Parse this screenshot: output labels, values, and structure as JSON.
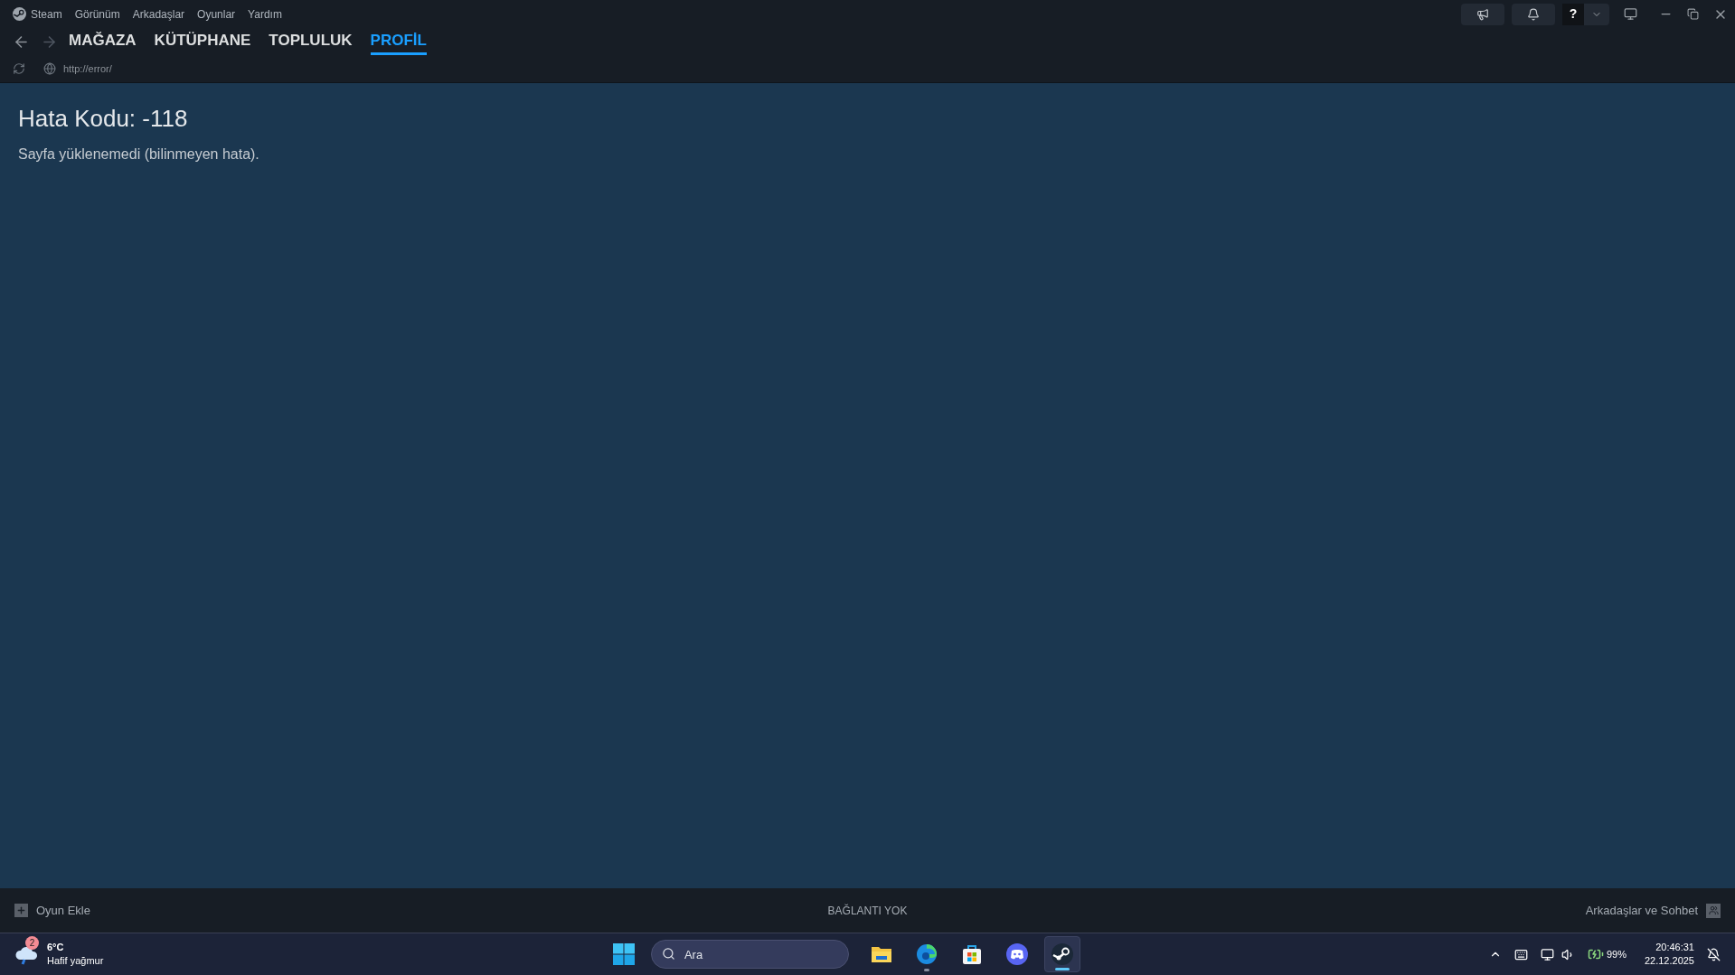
{
  "menu": [
    "Steam",
    "Görünüm",
    "Arkadaşlar",
    "Oyunlar",
    "Yardım"
  ],
  "tabs": [
    {
      "label": "MAĞAZA",
      "selected": false
    },
    {
      "label": "KÜTÜPHANE",
      "selected": false
    },
    {
      "label": "TOPLULUK",
      "selected": false
    },
    {
      "label": "PROFİL",
      "selected": true
    }
  ],
  "url": "http://error/",
  "help_label": "?",
  "error": {
    "title": "Hata Kodu: -118",
    "message": "Sayfa yüklenemedi (bilinmeyen hata)."
  },
  "footer": {
    "add_game": "Oyun Ekle",
    "status": "BAĞLANTI YOK",
    "friends": "Arkadaşlar ve Sohbet"
  },
  "taskbar": {
    "weather": {
      "badge": "2",
      "temp": "6°C",
      "desc": "Hafif yağmur"
    },
    "search": {
      "placeholder": "Ara"
    },
    "apps": [
      {
        "kind": "folder",
        "running": false,
        "selected": false
      },
      {
        "kind": "browser",
        "running": true,
        "selected": false
      },
      {
        "kind": "store",
        "running": false,
        "selected": false
      },
      {
        "kind": "chat",
        "running": false,
        "selected": false
      },
      {
        "kind": "steam",
        "running": true,
        "selected": true
      }
    ],
    "battery": "99%",
    "time": "20:46:31",
    "date": "22.12.2025"
  }
}
